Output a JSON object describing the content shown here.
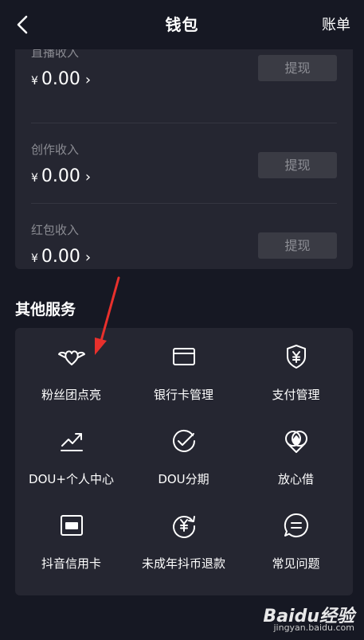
{
  "header": {
    "title": "钱包",
    "bill_label": "账单"
  },
  "income": [
    {
      "label": "直播收入",
      "currency": "¥",
      "amount": "0.00",
      "button": "提现"
    },
    {
      "label": "创作收入",
      "currency": "¥",
      "amount": "0.00",
      "button": "提现"
    },
    {
      "label": "红包收入",
      "currency": "¥",
      "amount": "0.00",
      "button": "提现"
    }
  ],
  "section_title": "其他服务",
  "services": [
    {
      "label": "粉丝团点亮",
      "icon": "heart-wings-icon"
    },
    {
      "label": "银行卡管理",
      "icon": "bank-card-icon"
    },
    {
      "label": "支付管理",
      "icon": "yuan-shield-icon"
    },
    {
      "label": "DOU+个人中心",
      "icon": "trend-up-icon"
    },
    {
      "label": "DOU分期",
      "icon": "check-circle-icon"
    },
    {
      "label": "放心借",
      "icon": "diamond-circles-icon"
    },
    {
      "label": "抖音信用卡",
      "icon": "credit-card-icon"
    },
    {
      "label": "未成年抖币退款",
      "icon": "yuan-refresh-icon"
    },
    {
      "label": "常见问题",
      "icon": "chat-bubble-icon"
    }
  ],
  "watermark": {
    "logo": "Baidu经验",
    "url": "jingyan.baidu.com"
  },
  "colors": {
    "background": "#161823",
    "card": "#252631",
    "button": "#3a3b44",
    "arrow": "#e8302c"
  }
}
